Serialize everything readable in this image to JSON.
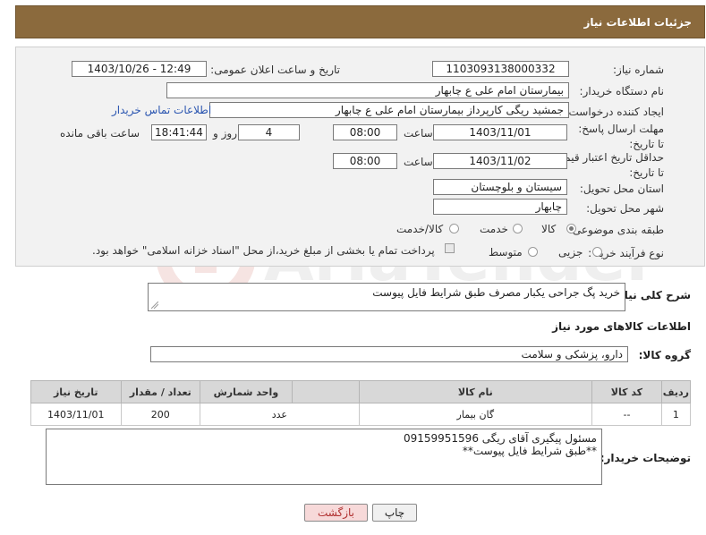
{
  "header": {
    "title": "جزئیات اطلاعات نیاز"
  },
  "form": {
    "need_number": {
      "label": "شماره نیاز:",
      "value": "1103093138000332"
    },
    "announce": {
      "label": "تاریخ و ساعت اعلان عمومی:",
      "value": "1403/10/26 - 12:49"
    },
    "buyer_org": {
      "label": "نام دستگاه خریدار:",
      "value": "بیمارستان امام علی  ع  چابهار"
    },
    "creator": {
      "label": "ایجاد کننده درخواست:",
      "value": "جمشید ریگی کارپرداز بیمارستان امام علی  ع  چابهار",
      "contact_link": "اطلاعات تماس خریدار"
    },
    "reply_deadline": {
      "label": "مهلت ارسال پاسخ: تا تاریخ:",
      "date": "1403/11/01",
      "time_label": "ساعت",
      "time": "08:00",
      "days": "4",
      "days_label": "روز و",
      "remaining": "18:41:44",
      "remaining_label": "ساعت باقی مانده"
    },
    "price_validity": {
      "label": "حداقل تاریخ اعتبار قیمت: تا تاریخ:",
      "date": "1403/11/02",
      "time_label": "ساعت",
      "time": "08:00"
    },
    "province": {
      "label": "استان محل تحویل:",
      "value": "سیستان و بلوچستان"
    },
    "city": {
      "label": "شهر محل تحویل:",
      "value": "چابهار"
    },
    "category": {
      "label": "طبقه بندی موضوعی:",
      "options": [
        "کالا",
        "خدمت",
        "کالا/خدمت"
      ],
      "selected": "کالا"
    },
    "process": {
      "label": "نوع فرآیند خرید :",
      "options": [
        "جزیی",
        "متوسط"
      ],
      "note": "پرداخت تمام یا بخشی از مبلغ خرید،از محل \"اسناد خزانه اسلامی\" خواهد بود."
    }
  },
  "description": {
    "label": "شرح کلی نیاز:",
    "value": "خرید پگ جراحی یکبار مصرف طبق شرایط فایل پیوست"
  },
  "goods_section": {
    "title": "اطلاعات کالاهای مورد نیاز"
  },
  "goods_group": {
    "label": "گروه کالا:",
    "value": "دارو، پزشکی و سلامت"
  },
  "table": {
    "headers": [
      "ردیف",
      "کد کالا",
      "نام کالا",
      "واحد شمارش",
      "تعداد / مقدار",
      "تاریخ نیاز"
    ],
    "rows": [
      [
        "1",
        "--",
        "گان بیمار",
        "عدد",
        "200",
        "1403/11/01"
      ]
    ]
  },
  "buyer_notes": {
    "label": "توضیحات خریدار:",
    "line1": "مسئول پیگیری آقای ریگی 09159951596",
    "line2": "**طبق شرایط فایل پیوست**"
  },
  "buttons": {
    "print": "چاپ",
    "back": "بازگشت"
  },
  "watermark": {
    "text": "AriaTender.net"
  },
  "colors": {
    "header_bg": "#8b6a3d",
    "link": "#2a55b0",
    "back_button_bg": "#f7d9d9"
  }
}
